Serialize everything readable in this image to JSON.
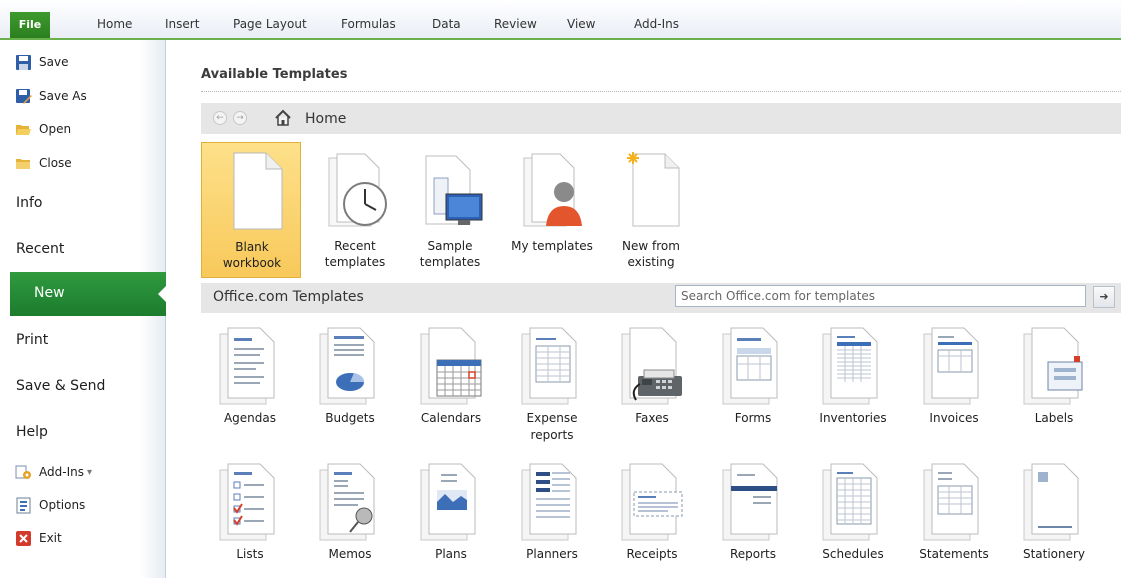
{
  "ribbon": {
    "file": "File",
    "tabs": [
      "Home",
      "Insert",
      "Page Layout",
      "Formulas",
      "Data",
      "Review",
      "View",
      "Add-Ins"
    ]
  },
  "backstage": {
    "commands_top": [
      {
        "label": "Save",
        "icon": "save-icon"
      },
      {
        "label": "Save As",
        "icon": "save-as-icon"
      },
      {
        "label": "Open",
        "icon": "open-folder-icon"
      },
      {
        "label": "Close",
        "icon": "close-folder-icon"
      }
    ],
    "tabs": [
      "Info",
      "Recent",
      "New",
      "Print",
      "Save & Send",
      "Help"
    ],
    "selected_tab": "New",
    "commands_bottom": [
      {
        "label": "Add-Ins",
        "icon": "add-ins-icon",
        "dropdown": "▾"
      },
      {
        "label": "Options",
        "icon": "options-icon"
      },
      {
        "label": "Exit",
        "icon": "exit-icon"
      }
    ]
  },
  "content": {
    "heading": "Available Templates",
    "nav": {
      "back": "←",
      "forward": "→",
      "location": "Home"
    },
    "templates": [
      {
        "line1": "Blank",
        "line2": "workbook",
        "icon": "blank-workbook-icon",
        "selected": true
      },
      {
        "line1": "Recent",
        "line2": "templates",
        "icon": "clock-icon"
      },
      {
        "line1": "Sample",
        "line2": "templates",
        "icon": "monitor-icon"
      },
      {
        "line1": "My templates",
        "line2": "",
        "icon": "person-icon"
      },
      {
        "line1": "New from",
        "line2": "existing",
        "icon": "sparkle-document-icon"
      }
    ],
    "officecom": {
      "title": "Office.com Templates",
      "search_value": "Search Office.com for templates",
      "go": "➜"
    },
    "categories_row1": [
      {
        "line1": "Agendas",
        "line2": ""
      },
      {
        "line1": "Budgets",
        "line2": ""
      },
      {
        "line1": "Calendars",
        "line2": ""
      },
      {
        "line1": "Expense",
        "line2": "reports"
      },
      {
        "line1": "Faxes",
        "line2": ""
      },
      {
        "line1": "Forms",
        "line2": ""
      },
      {
        "line1": "Inventories",
        "line2": ""
      },
      {
        "line1": "Invoices",
        "line2": ""
      },
      {
        "line1": "Labels",
        "line2": ""
      }
    ],
    "categories_row2": [
      {
        "line1": "Lists",
        "line2": ""
      },
      {
        "line1": "Memos",
        "line2": ""
      },
      {
        "line1": "Plans",
        "line2": ""
      },
      {
        "line1": "Planners",
        "line2": ""
      },
      {
        "line1": "Receipts",
        "line2": ""
      },
      {
        "line1": "Reports",
        "line2": ""
      },
      {
        "line1": "Schedules",
        "line2": ""
      },
      {
        "line1": "Statements",
        "line2": ""
      },
      {
        "line1": "Stationery",
        "line2": ""
      }
    ]
  },
  "colors": {
    "file_green": "#2f8c22",
    "new_selected_green": "#2a8f38",
    "selected_tile": "#f9d06a"
  }
}
